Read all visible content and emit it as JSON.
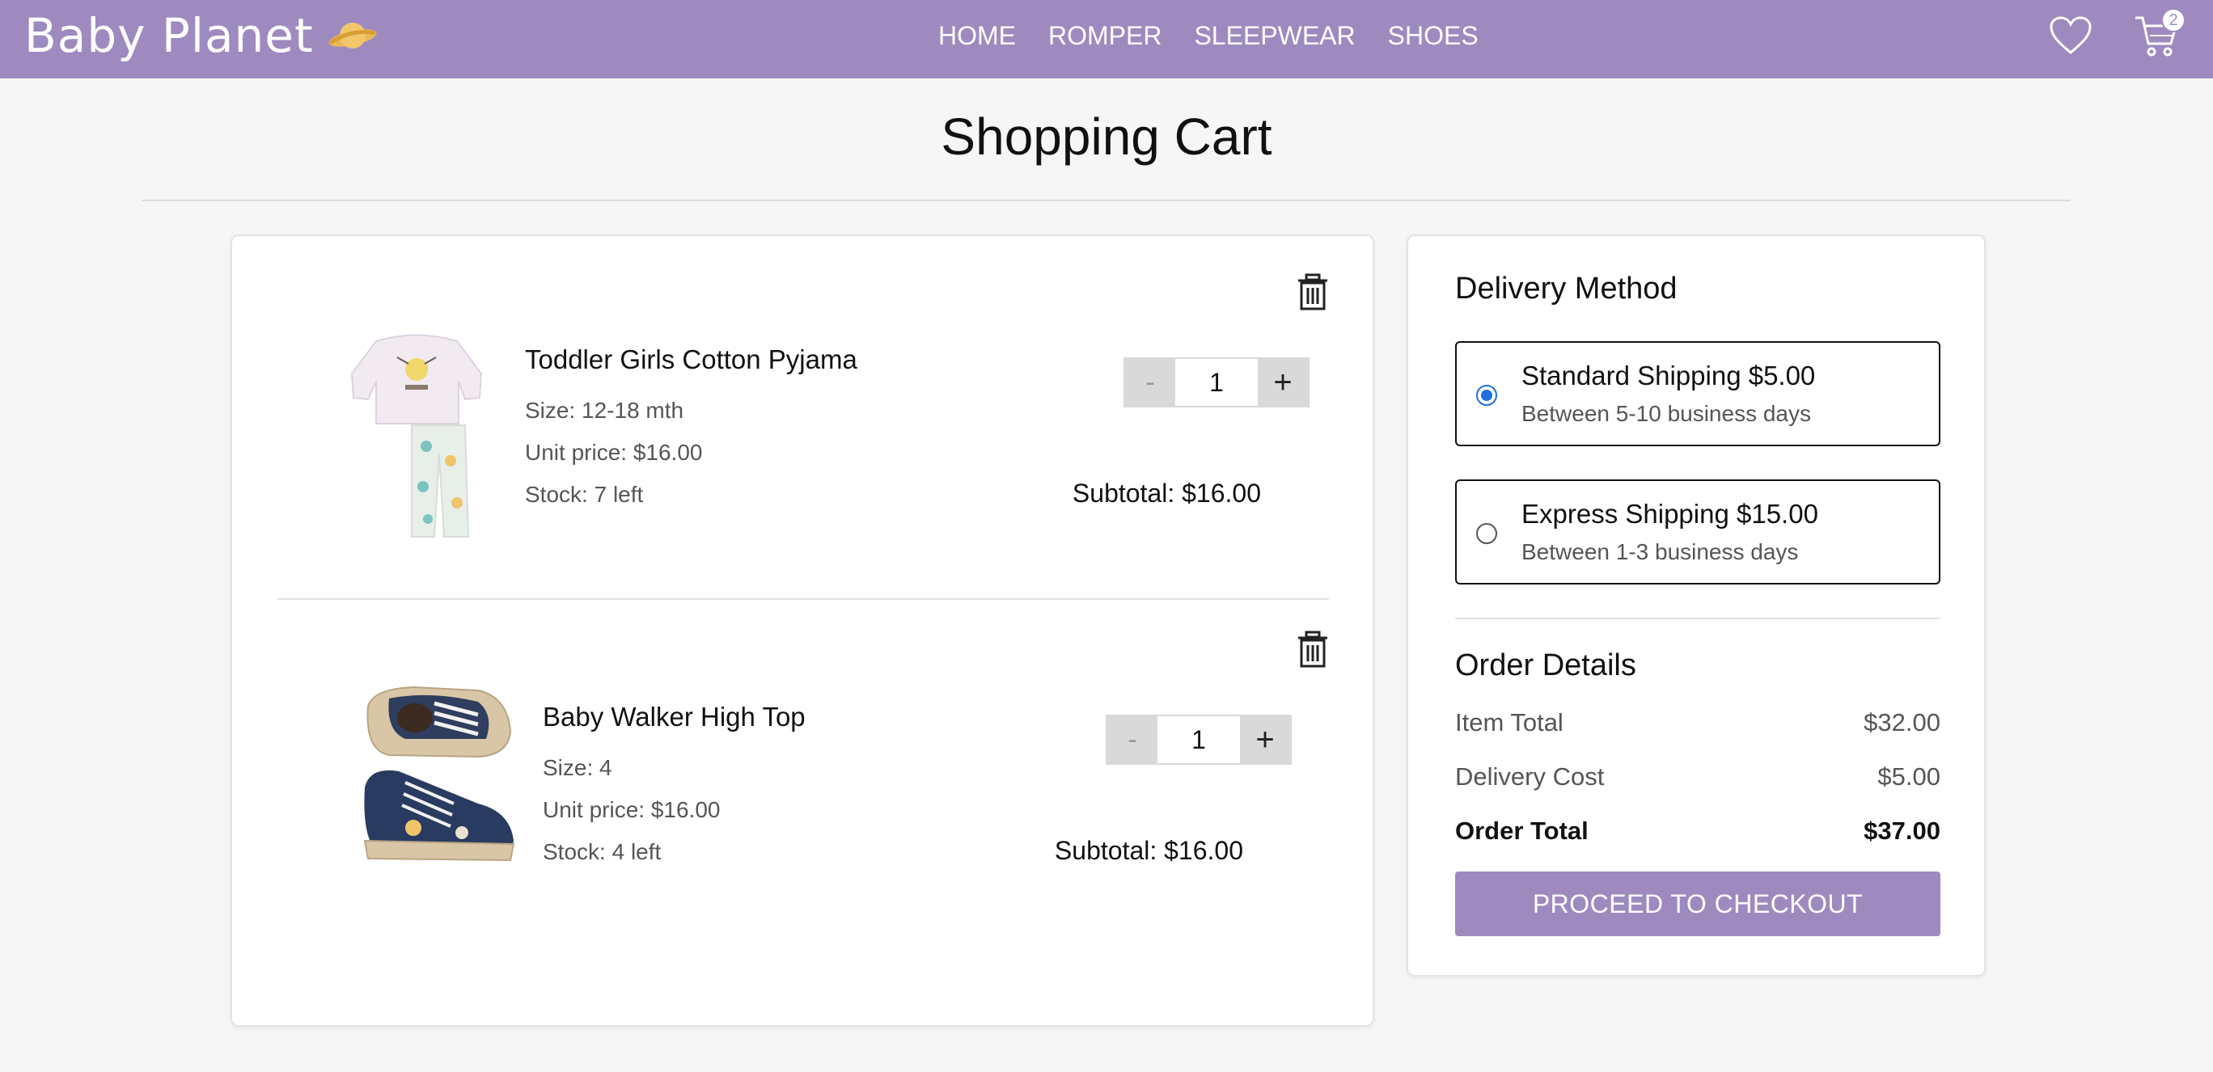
{
  "brand": {
    "name": "Baby Planet"
  },
  "nav": {
    "links": [
      "HOME",
      "ROMPER",
      "SLEEPWEAR",
      "SHOES"
    ],
    "cart_count": "2"
  },
  "page": {
    "title": "Shopping Cart"
  },
  "cart": {
    "items": [
      {
        "name": "Toddler Girls Cotton Pyjama",
        "size": "Size: 12-18 mth",
        "unit_price": "Unit price: $16.00",
        "stock": "Stock: 7 left",
        "quantity": "1",
        "subtotal": "Subtotal: $16.00"
      },
      {
        "name": "Baby Walker High Top",
        "size": "Size: 4",
        "unit_price": "Unit price: $16.00",
        "stock": "Stock: 4 left",
        "quantity": "1",
        "subtotal": "Subtotal: $16.00"
      }
    ],
    "minus_label": "-",
    "plus_label": "+"
  },
  "delivery": {
    "title": "Delivery Method",
    "options": [
      {
        "label": "Standard Shipping $5.00",
        "desc": "Between 5-10 business days",
        "selected": true
      },
      {
        "label": "Express Shipping $15.00",
        "desc": "Between 1-3 business days",
        "selected": false
      }
    ]
  },
  "order": {
    "title": "Order Details",
    "item_total_label": "Item Total",
    "item_total": "$32.00",
    "delivery_cost_label": "Delivery Cost",
    "delivery_cost": "$5.00",
    "order_total_label": "Order Total",
    "order_total": "$37.00",
    "checkout_label": "PROCEED TO CHECKOUT"
  },
  "colors": {
    "brand": "#9e8abf",
    "radio": "#1f6fe0"
  }
}
